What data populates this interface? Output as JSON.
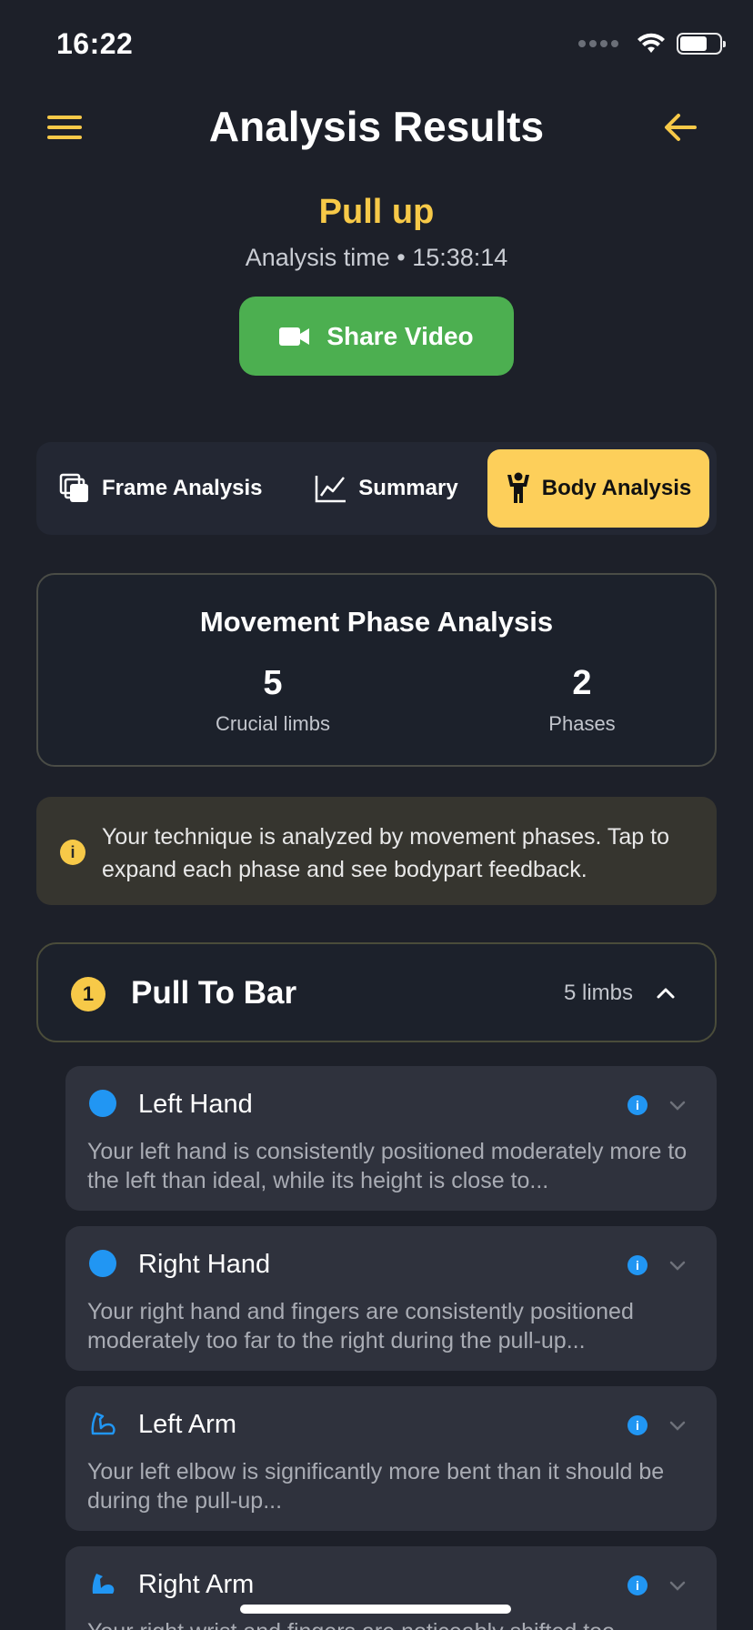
{
  "status_bar": {
    "time": "16:22"
  },
  "header": {
    "title": "Analysis Results"
  },
  "exercise": {
    "name": "Pull up",
    "analysis_time": "Analysis time • 15:38:14"
  },
  "share": {
    "label": "Share Video"
  },
  "tabs": [
    {
      "label": "Frame Analysis",
      "icon": "copy-icon",
      "active": false
    },
    {
      "label": "Summary",
      "icon": "chart-line-icon",
      "active": false
    },
    {
      "label": "Body Analysis",
      "icon": "person-icon",
      "active": true
    }
  ],
  "movement": {
    "title": "Movement Phase Analysis",
    "stats": [
      {
        "value": "5",
        "label": "Crucial limbs"
      },
      {
        "value": "2",
        "label": "Phases"
      }
    ]
  },
  "info": {
    "text": "Your technique is analyzed by movement phases. Tap to expand each phase and see bodypart feedback."
  },
  "phase": {
    "number": "1",
    "title": "Pull To Bar",
    "count": "5 limbs"
  },
  "limbs": [
    {
      "title": "Left Hand",
      "icon": "hand-dot-icon",
      "text": "Your left hand is consistently positioned moderately more to the left than ideal, while its height is close to..."
    },
    {
      "title": "Right Hand",
      "icon": "hand-dot-icon",
      "text": "Your right hand and fingers are consistently positioned moderately too far to the right during the pull-up..."
    },
    {
      "title": "Left Arm",
      "icon": "arm-outline-icon",
      "text": "Your left elbow is significantly more bent than it should be during the pull-up..."
    },
    {
      "title": "Right Arm",
      "icon": "arm-filled-icon",
      "text": "Your right wrist and fingers are noticeably shifted too"
    }
  ],
  "colors": {
    "accent": "#f7c948",
    "share_green": "#4caf50",
    "limb_blue": "#2196f3",
    "background": "#1d2029"
  }
}
